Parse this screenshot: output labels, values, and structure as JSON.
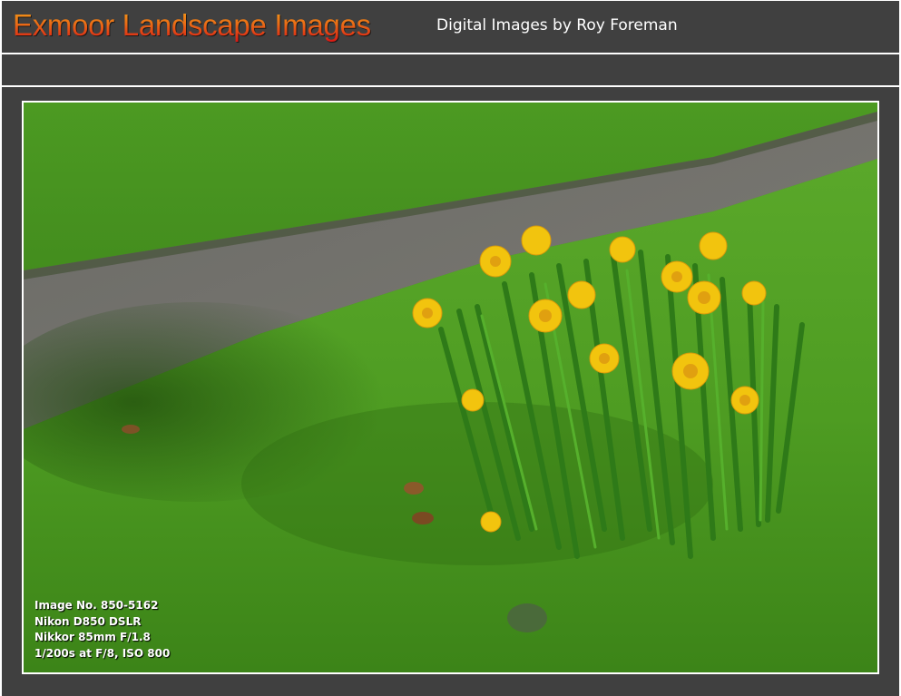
{
  "header": {
    "site_title": "Exmoor Landscape Images",
    "subtitle": "Digital Images by Roy Foreman",
    "title_gradient": [
      "#f4a018",
      "#ea6d16",
      "#d81414"
    ],
    "bar_color": "#404040"
  },
  "photo": {
    "subject": "daffodils",
    "exif": {
      "image_no": "Image No. 850-5162",
      "camera": "Nikon D850 DSLR",
      "lens": "Nikkor 85mm F/1.8",
      "settings": "1/200s at F/8,  ISO 800"
    }
  }
}
